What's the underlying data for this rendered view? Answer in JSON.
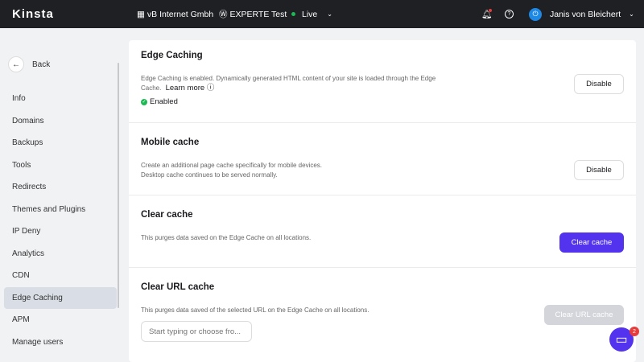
{
  "header": {
    "logo": "Kinsta",
    "company": "vB Internet Gmbh",
    "site": "EXPERTE Test",
    "environment": "Live",
    "user": "Janis von Bleichert"
  },
  "sidebar": {
    "back": "Back",
    "items": [
      {
        "label": "Info"
      },
      {
        "label": "Domains"
      },
      {
        "label": "Backups"
      },
      {
        "label": "Tools"
      },
      {
        "label": "Redirects"
      },
      {
        "label": "Themes and Plugins"
      },
      {
        "label": "IP Deny"
      },
      {
        "label": "Analytics"
      },
      {
        "label": "CDN"
      },
      {
        "label": "Edge Caching",
        "active": true
      },
      {
        "label": "APM"
      },
      {
        "label": "Manage users"
      }
    ]
  },
  "sections": {
    "edge": {
      "title": "Edge Caching",
      "desc": "Edge Caching is enabled. Dynamically generated HTML content of your site is loaded through the Edge Cache.",
      "learn_more": "Learn more",
      "status": "Enabled",
      "button": "Disable"
    },
    "mobile": {
      "title": "Mobile cache",
      "desc1": "Create an additional page cache specifically for mobile devices.",
      "desc2": "Desktop cache continues to be served normally.",
      "button": "Disable"
    },
    "clear": {
      "title": "Clear cache",
      "desc": "This purges data saved on the Edge Cache on all locations.",
      "button": "Clear cache"
    },
    "url": {
      "title": "Clear URL cache",
      "desc": "This purges data saved of the selected URL on the Edge Cache on all locations.",
      "placeholder": "Start typing or choose fro...",
      "button": "Clear URL cache"
    }
  },
  "chat": {
    "badge": "2"
  },
  "colors": {
    "accent": "#5333ed",
    "live": "#1db954"
  }
}
